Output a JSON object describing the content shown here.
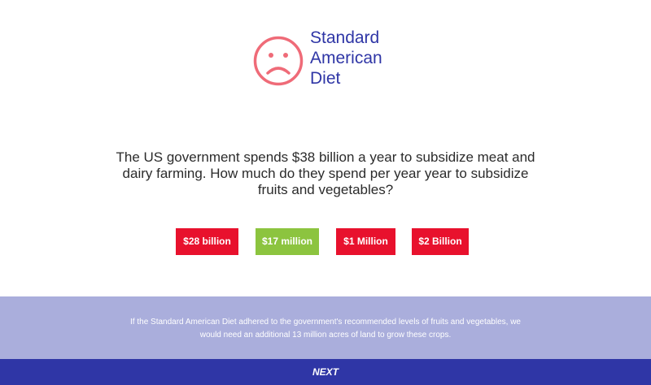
{
  "logo": {
    "line1": "Standard",
    "line2": "American",
    "line3": "Diet",
    "icon": "sad-face-icon",
    "icon_color": "#ef6b78",
    "text_color": "#2f36a6"
  },
  "question": {
    "text": "The US government spends $38 billion a year to subsidize meat and dairy farming. How much do they spend per year year to subsidize fruits and vegetables?"
  },
  "answers": [
    {
      "label": "$28 billion",
      "color": "#e8112d"
    },
    {
      "label": "$17 million",
      "color": "#8cc43f"
    },
    {
      "label": "$1 Million",
      "color": "#e8112d"
    },
    {
      "label": "$2 Billion",
      "color": "#e8112d"
    }
  ],
  "fact": {
    "text": "If the Standard American Diet adhered to the government's recommended levels of fruits and vegetables, we would need an additional 13 million acres of land to grow these crops.",
    "background": "#aaaedc"
  },
  "footer": {
    "next_label": "NEXT",
    "background": "#2f36a6"
  }
}
